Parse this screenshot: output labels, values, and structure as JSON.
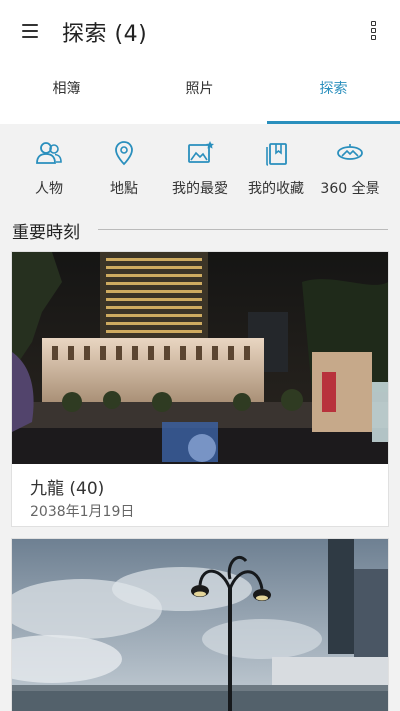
{
  "header": {
    "title": "探索 (4)"
  },
  "tabs": [
    {
      "label": "相簿",
      "active": false
    },
    {
      "label": "照片",
      "active": false
    },
    {
      "label": "探索",
      "active": true
    }
  ],
  "categories": [
    {
      "label": "人物",
      "icon": "people-icon"
    },
    {
      "label": "地點",
      "icon": "location-pin-icon"
    },
    {
      "label": "我的最愛",
      "icon": "favorite-photo-icon"
    },
    {
      "label": "我的收藏",
      "icon": "collection-icon"
    },
    {
      "label": "360 全景",
      "icon": "panorama-360-icon"
    }
  ],
  "section": {
    "title": "重要時刻"
  },
  "moments": [
    {
      "title": "九龍 (40)",
      "date": "2038年1月19日"
    }
  ],
  "colors": {
    "accent": "#2a8fbd",
    "background": "#f2f2f2"
  }
}
